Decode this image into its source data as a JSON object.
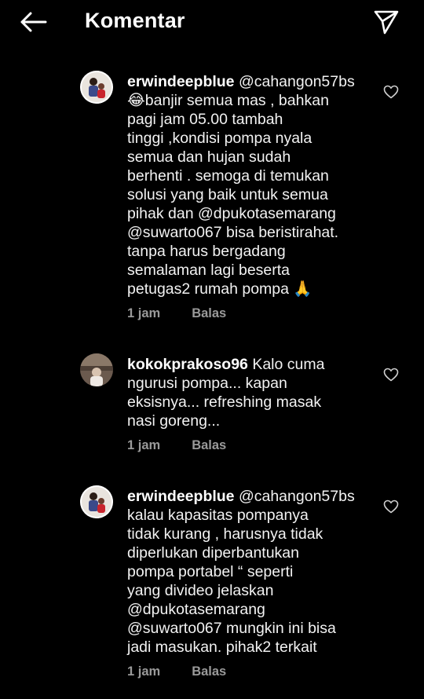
{
  "header": {
    "title": "Komentar",
    "back_icon": "back-arrow-icon",
    "send_icon": "paper-plane-icon"
  },
  "comments": [
    {
      "username": "erwindeepblue",
      "lines": [
        " @cahangon57bs",
        "😂banjir semua mas ,  bahkan",
        "pagi jam 05.00 tambah",
        "tinggi ,kondisi pompa nyala",
        "semua dan  hujan sudah",
        "berhenti . semoga di temukan",
        "solusi yang baik untuk semua",
        "pihak dan @dpukotasemarang",
        "@suwarto067  bisa  beristirahat.",
        "tanpa harus bergadang",
        "semalaman lagi beserta",
        "petugas2 rumah pompa 🙏"
      ],
      "time": "1 jam",
      "reply": "Balas"
    },
    {
      "username": "kokokprakoso96",
      "lines": [
        " Kalo cuma",
        "ngurusi pompa... kapan",
        "eksisnya... refreshing masak",
        "nasi goreng..."
      ],
      "time": "1 jam",
      "reply": "Balas"
    },
    {
      "username": "erwindeepblue",
      "lines": [
        " @cahangon57bs",
        "kalau  kapasitas pompanya",
        "tidak kurang , harusnya tidak",
        "diperlukan diperbantukan",
        "pompa portabel “ seperti",
        "yang divideo jelaskan",
        "@dpukotasemarang",
        "@suwarto067  mungkin ini bisa",
        "jadi masukan. pihak2 terkait"
      ],
      "time": "1 jam",
      "reply": "Balas"
    }
  ]
}
